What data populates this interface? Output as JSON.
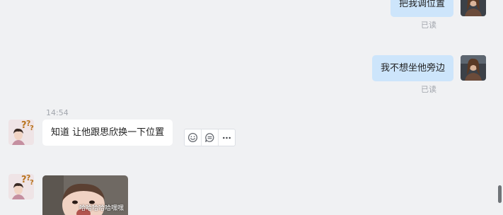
{
  "messages_out": [
    {
      "text": "把我调位置",
      "status": "已读"
    },
    {
      "text": "我不想坐他旁边",
      "status": "已读"
    }
  ],
  "timestamp": "14:54",
  "messages_in": [
    {
      "text": "知道 让他跟思欣换一下位置"
    },
    {
      "image_caption": "哈哈哈哈哈嘿嘿"
    }
  ],
  "toolbar": {
    "icons": [
      "emoji-reaction-icon",
      "quote-reply-icon",
      "more-options-icon"
    ]
  },
  "colors": {
    "background": "#f0f1f3",
    "outgoing_bubble": "#cde5fb",
    "incoming_bubble": "#ffffff",
    "secondary_text": "#a2a6ad",
    "scrollbar": "#707478"
  }
}
